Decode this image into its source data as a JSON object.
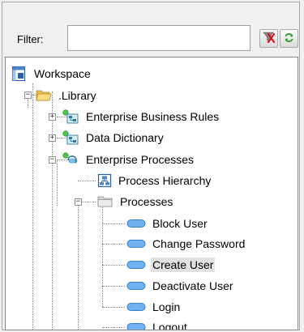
{
  "filter": {
    "label": "Filter:",
    "value": "",
    "clear_icon": "funnel-clear-icon",
    "refresh_icon": "refresh-icon"
  },
  "tree": {
    "workspace": {
      "label": "Workspace",
      "icon": "workspace-icon"
    },
    "library": {
      "label": ".Library",
      "icon": "folder-open-icon"
    },
    "business_rules": {
      "label": "Enterprise Business Rules",
      "icon": "model-icon"
    },
    "data_dictionary": {
      "label": "Data Dictionary",
      "icon": "model-icon"
    },
    "enterprise_processes": {
      "label": "Enterprise Processes",
      "icon": "process-model-icon"
    },
    "process_hierarchy": {
      "label": "Process Hierarchy",
      "icon": "diagram-icon"
    },
    "processes": {
      "label": "Processes",
      "icon": "folder-icon"
    },
    "process_items": [
      {
        "label": "Block User"
      },
      {
        "label": "Change Password"
      },
      {
        "label": "Create User",
        "selected": true
      },
      {
        "label": "Deactivate User"
      },
      {
        "label": "Login"
      },
      {
        "label": "Logout"
      }
    ]
  },
  "colors": {
    "selection": "#e2e2e2",
    "process_pill": "#6fb2ef",
    "folder": "#f4d37b"
  }
}
